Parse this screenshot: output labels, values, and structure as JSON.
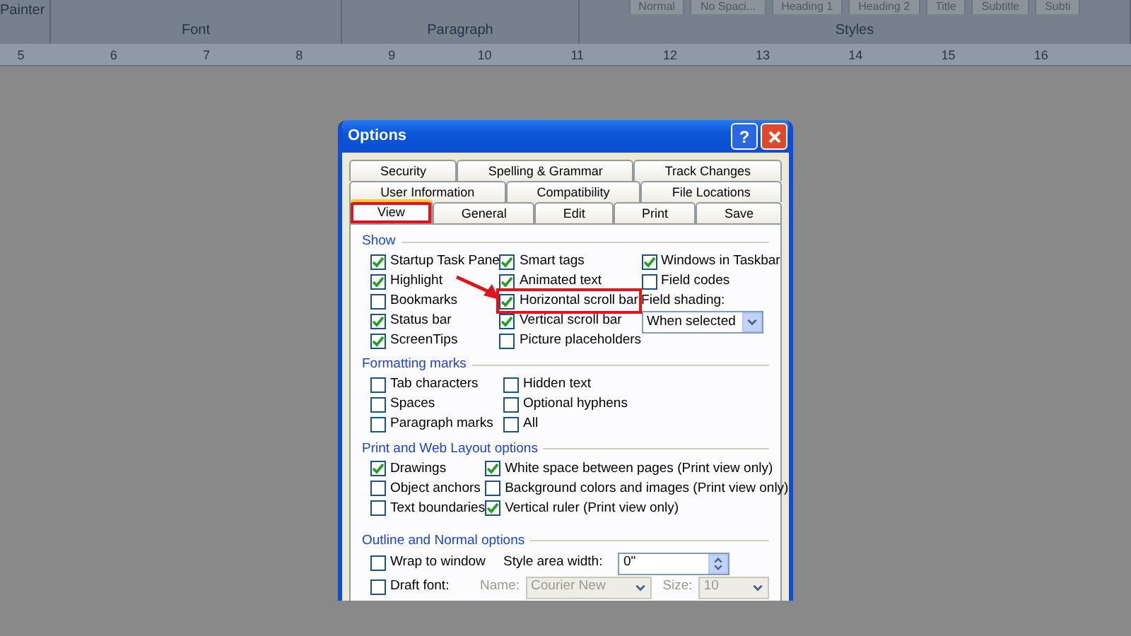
{
  "ribbon": {
    "clipboard_label": "Painter",
    "groups": [
      {
        "label": "Font"
      },
      {
        "label": "Paragraph"
      },
      {
        "label": "Styles"
      }
    ],
    "styles": [
      "Normal",
      "No Spaci...",
      "Heading 1",
      "Heading 2",
      "Title",
      "Subtitle",
      "Subti"
    ]
  },
  "ruler": {
    "numbers": [
      "5",
      "6",
      "7",
      "8",
      "9",
      "10",
      "11",
      "12",
      "13",
      "14",
      "15",
      "16"
    ]
  },
  "dialog": {
    "title": "Options",
    "help_button": "?",
    "tab_rows": [
      [
        {
          "label": "Security",
          "selected": false,
          "highlighted": false
        },
        {
          "label": "Spelling & Grammar",
          "selected": false,
          "highlighted": false
        },
        {
          "label": "Track Changes",
          "selected": false,
          "highlighted": false
        }
      ],
      [
        {
          "label": "User Information",
          "selected": false,
          "highlighted": false
        },
        {
          "label": "Compatibility",
          "selected": false,
          "highlighted": false
        },
        {
          "label": "File Locations",
          "selected": false,
          "highlighted": false
        }
      ],
      [
        {
          "label": "View",
          "selected": true,
          "highlighted": true
        },
        {
          "label": "General",
          "selected": false,
          "highlighted": false
        },
        {
          "label": "Edit",
          "selected": false,
          "highlighted": false
        },
        {
          "label": "Print",
          "selected": false,
          "highlighted": false
        },
        {
          "label": "Save",
          "selected": false,
          "highlighted": false
        }
      ]
    ],
    "sections": [
      {
        "title": "Show",
        "columns": [
          [
            {
              "kind": "checkbox",
              "label": "Startup Task Pane",
              "checked": true,
              "highlighted": false
            },
            {
              "kind": "checkbox",
              "label": "Highlight",
              "checked": true,
              "highlighted": false
            },
            {
              "kind": "checkbox",
              "label": "Bookmarks",
              "checked": false,
              "highlighted": false
            },
            {
              "kind": "checkbox",
              "label": "Status bar",
              "checked": true,
              "highlighted": false
            },
            {
              "kind": "checkbox",
              "label": "ScreenTips",
              "checked": true,
              "highlighted": false
            }
          ],
          [
            {
              "kind": "checkbox",
              "label": "Smart tags",
              "checked": true,
              "highlighted": false
            },
            {
              "kind": "checkbox",
              "label": "Animated text",
              "checked": true,
              "highlighted": false
            },
            {
              "kind": "checkbox",
              "label": "Horizontal scroll bar",
              "checked": true,
              "highlighted": true
            },
            {
              "kind": "checkbox",
              "label": "Vertical scroll bar",
              "checked": true,
              "highlighted": false
            },
            {
              "kind": "checkbox",
              "label": "Picture placeholders",
              "checked": false,
              "highlighted": false
            }
          ],
          [
            {
              "kind": "checkbox",
              "label": "Windows in Taskbar",
              "checked": true,
              "highlighted": false
            },
            {
              "kind": "checkbox",
              "label": "Field codes",
              "checked": false,
              "highlighted": false
            },
            {
              "kind": "label",
              "label": "Field shading:"
            },
            {
              "kind": "select",
              "value": "When selected"
            }
          ]
        ]
      },
      {
        "title": "Formatting marks",
        "columns": [
          [
            {
              "kind": "checkbox",
              "label": "Tab characters",
              "checked": false,
              "highlighted": false
            },
            {
              "kind": "checkbox",
              "label": "Spaces",
              "checked": false,
              "highlighted": false
            },
            {
              "kind": "checkbox",
              "label": "Paragraph marks",
              "checked": false,
              "highlighted": false
            }
          ],
          [
            {
              "kind": "checkbox",
              "label": "Hidden text",
              "checked": false,
              "highlighted": false
            },
            {
              "kind": "checkbox",
              "label": "Optional hyphens",
              "checked": false,
              "highlighted": false
            },
            {
              "kind": "checkbox",
              "label": "All",
              "checked": false,
              "highlighted": false
            }
          ]
        ]
      },
      {
        "title": "Print and Web Layout options",
        "columns": [
          [
            {
              "kind": "checkbox",
              "label": "Drawings",
              "checked": true,
              "highlighted": false
            },
            {
              "kind": "checkbox",
              "label": "Object anchors",
              "checked": false,
              "highlighted": false
            },
            {
              "kind": "checkbox",
              "label": "Text boundaries",
              "checked": false,
              "highlighted": false
            }
          ],
          [
            {
              "kind": "checkbox",
              "label": "White space between pages (Print view only)",
              "checked": true,
              "highlighted": false
            },
            {
              "kind": "checkbox",
              "label": "Background colors and images (Print view only)",
              "checked": false,
              "highlighted": false
            },
            {
              "kind": "checkbox",
              "label": "Vertical ruler (Print view only)",
              "checked": true,
              "highlighted": false
            }
          ]
        ]
      }
    ],
    "outline": {
      "title": "Outline and Normal options",
      "wrap_to_window": {
        "label": "Wrap to window",
        "checked": false
      },
      "style_area_width": {
        "label": "Style area width:",
        "value": "0\""
      },
      "draft_font": {
        "label": "Draft font:",
        "checked": false
      },
      "name": {
        "label": "Name:",
        "value": "Courier New",
        "disabled": true
      },
      "size": {
        "label": "Size:",
        "value": "10",
        "disabled": true
      }
    }
  }
}
